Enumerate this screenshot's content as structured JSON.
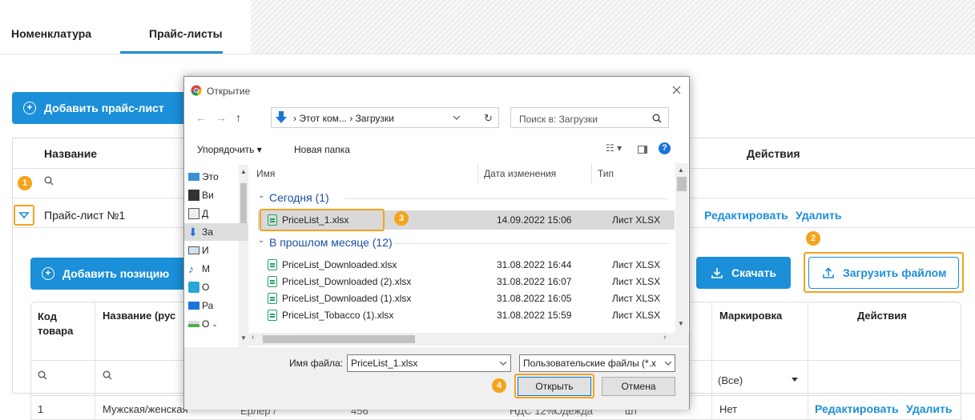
{
  "tabs": {
    "items": [
      "Номенклатура",
      "Прайс-листы"
    ]
  },
  "pricelists": {
    "add_label": "Добавить прайс-лист",
    "col_name": "Название",
    "col_actions": "Действия",
    "row_name": "Прайс-лист №1",
    "edit": "Редактировать",
    "delete": "Удалить"
  },
  "positions": {
    "add_label": "Добавить позицию",
    "download_label": "Скачать",
    "upload_label": "Загрузить файлом",
    "col_code": "Код товара",
    "col_name": "Название (рус",
    "col_marking": "Маркировка",
    "col_actions": "Действия",
    "filter_all": "(Все)",
    "row": {
      "code": "1",
      "name": "Мужская/женская",
      "brand": "Ерлер /",
      "num": "456",
      "vat": "НДС 12%",
      "cat": "Одежда",
      "unit": "шт",
      "marking": "Нет",
      "edit": "Редактировать",
      "delete": "Удалить"
    }
  },
  "badges": [
    "1",
    "2",
    "3",
    "4"
  ],
  "dialog": {
    "title": "Открытие",
    "path": [
      "Этот ком...",
      "Загрузки"
    ],
    "search_placeholder": "Поиск в: Загрузки",
    "organize": "Упорядочить",
    "new_folder": "Новая папка",
    "nav_items": [
      "Это",
      "Ви",
      "Д",
      "За",
      "И",
      "М",
      "О",
      "Ра",
      "О"
    ],
    "col_name": "Имя",
    "col_date": "Дата изменения",
    "col_type": "Тип",
    "groups": [
      {
        "label": "Сегодня (1)",
        "files": [
          {
            "name": "PriceList_1.xlsx",
            "date": "14.09.2022 15:06",
            "type": "Лист XLSX"
          }
        ]
      },
      {
        "label": "В прошлом месяце (12)",
        "files": [
          {
            "name": "PriceList_Downloaded.xlsx",
            "date": "31.08.2022 16:44",
            "type": "Лист XLSX"
          },
          {
            "name": "PriceList_Downloaded (2).xlsx",
            "date": "31.08.2022 16:07",
            "type": "Лист XLSX"
          },
          {
            "name": "PriceList_Downloaded (1).xlsx",
            "date": "31.08.2022 16:05",
            "type": "Лист XLSX"
          },
          {
            "name": "PriceList_Tobacco (1).xlsx",
            "date": "31.08.2022 15:59",
            "type": "Лист XLSX"
          }
        ]
      }
    ],
    "filename_label": "Имя файла:",
    "filename_value": "PriceList_1.xlsx",
    "filetype": "Пользовательские файлы (*.x",
    "open": "Открыть",
    "cancel": "Отмена"
  },
  "colors": {
    "accent": "#1b8fd8",
    "badge": "#f5a31a",
    "excel": "#21a366"
  }
}
